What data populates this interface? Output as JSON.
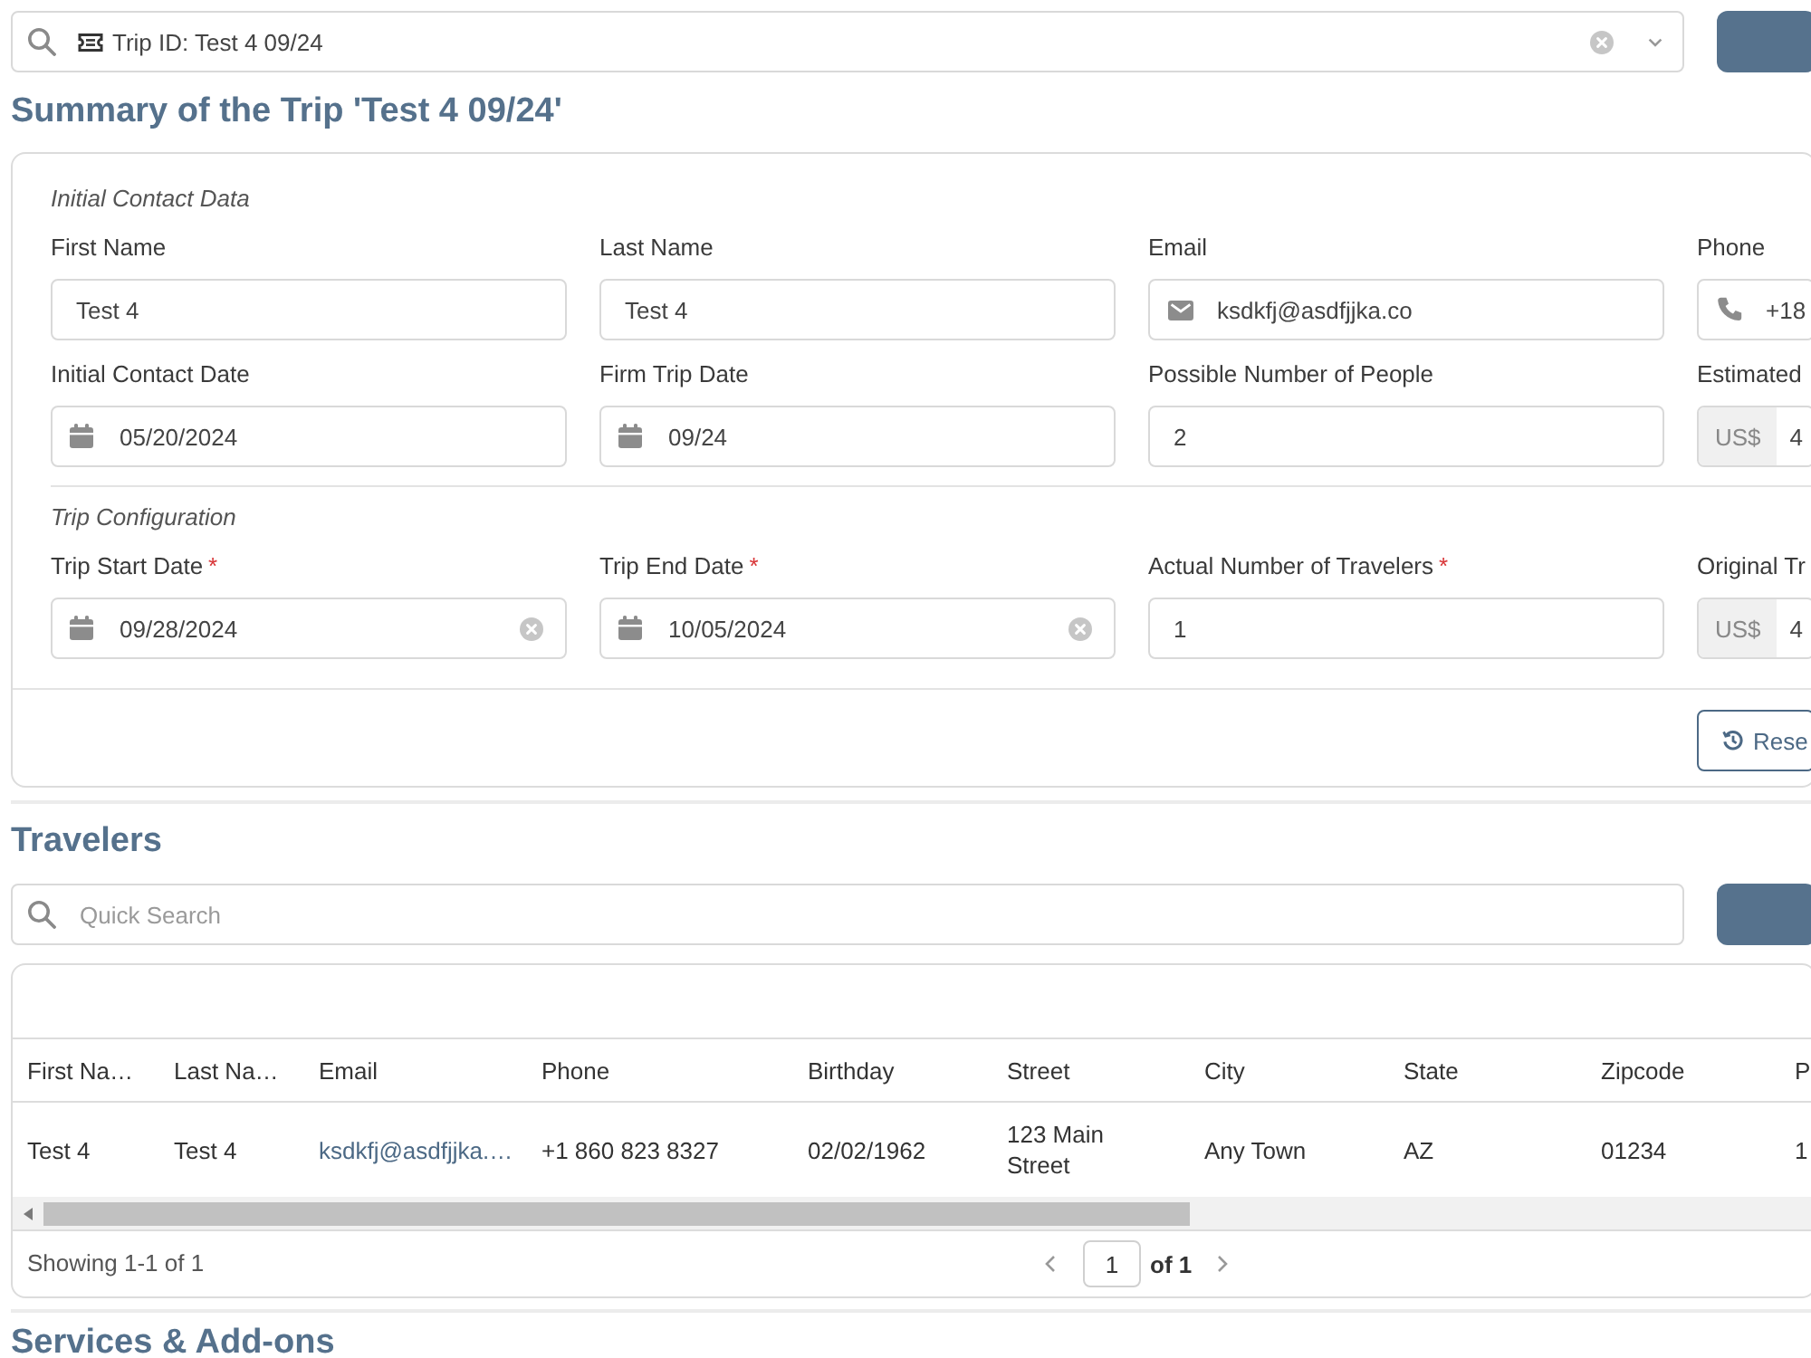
{
  "trip_selector": {
    "value": "Trip ID: Test 4 09/24",
    "clearable": true
  },
  "summary": {
    "title": "Summary of the Trip 'Test 4 09/24'",
    "sections": [
      {
        "title": "Initial Contact Data",
        "fields": [
          {
            "label": "First Name",
            "kind": "text",
            "value": "Test 4",
            "clearable": false
          },
          {
            "label": "Last Name",
            "kind": "text",
            "value": "Test 4",
            "clearable": false
          },
          {
            "label": "Email",
            "kind": "email",
            "value": "ksdkfj@asdfjjka.co",
            "clearable": false
          },
          {
            "label": "Phone",
            "kind": "phone",
            "value": "+18",
            "clearable": false
          },
          {
            "label": "Initial Contact Date",
            "kind": "date",
            "value": "05/20/2024",
            "clearable": false
          },
          {
            "label": "Firm Trip Date",
            "kind": "date",
            "value": "09/24",
            "clearable": false
          },
          {
            "label": "Possible Number of People",
            "kind": "text",
            "value": "2",
            "clearable": false
          },
          {
            "label": "Estimated",
            "kind": "currency",
            "prefix": "US$",
            "value": "4",
            "clearable": false
          }
        ]
      },
      {
        "title": "Trip Configuration",
        "fields": [
          {
            "label": "Trip Start Date",
            "required_mark": "*",
            "kind": "date",
            "value": "09/28/2024",
            "clearable": true
          },
          {
            "label": "Trip End Date",
            "required_mark": "*",
            "kind": "date",
            "value": "10/05/2024",
            "clearable": true
          },
          {
            "label": "Actual Number of Travelers",
            "required_mark": "*",
            "kind": "text",
            "value": "1",
            "clearable": false
          },
          {
            "label": "Original Tr",
            "kind": "currency",
            "prefix": "US$",
            "value": "4",
            "clearable": false
          }
        ]
      }
    ],
    "reset_button": "Rese"
  },
  "travelers": {
    "title": "Travelers",
    "search": {
      "placeholder": "Quick Search"
    },
    "table": {
      "columns": [
        {
          "label": "First Na…",
          "kind": "text"
        },
        {
          "label": "Last Na…",
          "kind": "text"
        },
        {
          "label": "Email",
          "kind": "link"
        },
        {
          "label": "Phone",
          "kind": "text"
        },
        {
          "label": "Birthday",
          "kind": "text"
        },
        {
          "label": "Street",
          "kind": "text"
        },
        {
          "label": "City",
          "kind": "text"
        },
        {
          "label": "State",
          "kind": "text"
        },
        {
          "label": "Zipcode",
          "kind": "text"
        },
        {
          "label": "P",
          "kind": "text"
        }
      ],
      "rows": [
        [
          "Test 4",
          "Test 4",
          "ksdkfj@asdfjjka.…",
          "+1 860 823 8327",
          "02/02/1962",
          "123 Main Street",
          "Any Town",
          "AZ",
          "01234",
          "1"
        ]
      ]
    },
    "footer": {
      "showing": "Showing 1-1 of 1",
      "page": "1",
      "total": "of 1"
    }
  },
  "services": {
    "title": "Services & Add-ons"
  }
}
